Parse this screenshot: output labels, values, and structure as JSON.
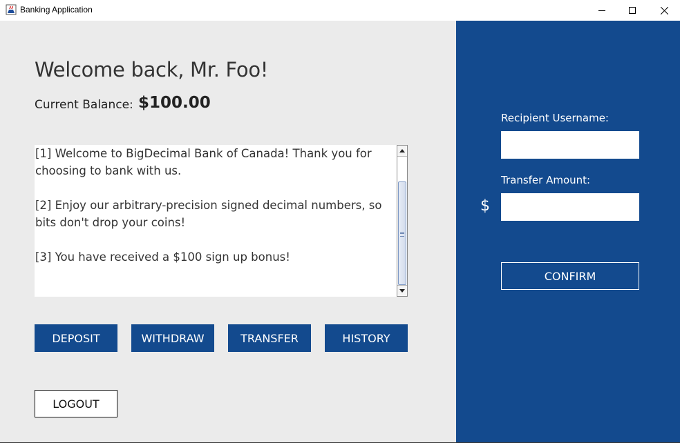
{
  "window": {
    "title": "Banking Application",
    "app_icon": "java-cup-icon",
    "controls": [
      "minimize",
      "maximize",
      "close"
    ]
  },
  "colors": {
    "brand_blue": "#134a8e",
    "left_panel_bg": "#ebebeb",
    "text_dark": "#333333"
  },
  "main": {
    "welcome": "Welcome back, Mr. Foo!",
    "balance_label": "Current Balance:",
    "balance_value": "$100.00",
    "messages": "[1] Welcome to BigDecimal Bank of Canada! Thank you for choosing to bank with us.\n\n[2] Enjoy our arbitrary-precision signed decimal numbers, so bits don't drop your coins!\n\n[3] You have received a $100 sign up bonus!",
    "buttons": {
      "deposit": "DEPOSIT",
      "withdraw": "WITHDRAW",
      "transfer": "TRANSFER",
      "history": "HISTORY"
    },
    "logout": "LOGOUT"
  },
  "transfer_panel": {
    "recipient_label": "Recipient Username:",
    "recipient_value": "",
    "amount_label": "Transfer Amount:",
    "currency_symbol": "$",
    "amount_value": "",
    "confirm": "CONFIRM"
  }
}
